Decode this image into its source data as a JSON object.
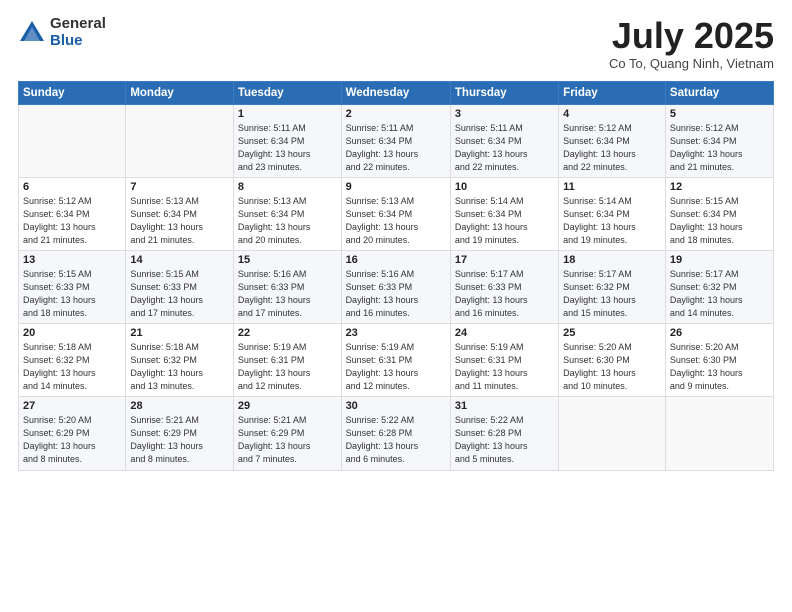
{
  "logo": {
    "general": "General",
    "blue": "Blue"
  },
  "title": "July 2025",
  "location": "Co To, Quang Ninh, Vietnam",
  "headers": [
    "Sunday",
    "Monday",
    "Tuesday",
    "Wednesday",
    "Thursday",
    "Friday",
    "Saturday"
  ],
  "weeks": [
    [
      {
        "day": "",
        "info": ""
      },
      {
        "day": "",
        "info": ""
      },
      {
        "day": "1",
        "info": "Sunrise: 5:11 AM\nSunset: 6:34 PM\nDaylight: 13 hours\nand 23 minutes."
      },
      {
        "day": "2",
        "info": "Sunrise: 5:11 AM\nSunset: 6:34 PM\nDaylight: 13 hours\nand 22 minutes."
      },
      {
        "day": "3",
        "info": "Sunrise: 5:11 AM\nSunset: 6:34 PM\nDaylight: 13 hours\nand 22 minutes."
      },
      {
        "day": "4",
        "info": "Sunrise: 5:12 AM\nSunset: 6:34 PM\nDaylight: 13 hours\nand 22 minutes."
      },
      {
        "day": "5",
        "info": "Sunrise: 5:12 AM\nSunset: 6:34 PM\nDaylight: 13 hours\nand 21 minutes."
      }
    ],
    [
      {
        "day": "6",
        "info": "Sunrise: 5:12 AM\nSunset: 6:34 PM\nDaylight: 13 hours\nand 21 minutes."
      },
      {
        "day": "7",
        "info": "Sunrise: 5:13 AM\nSunset: 6:34 PM\nDaylight: 13 hours\nand 21 minutes."
      },
      {
        "day": "8",
        "info": "Sunrise: 5:13 AM\nSunset: 6:34 PM\nDaylight: 13 hours\nand 20 minutes."
      },
      {
        "day": "9",
        "info": "Sunrise: 5:13 AM\nSunset: 6:34 PM\nDaylight: 13 hours\nand 20 minutes."
      },
      {
        "day": "10",
        "info": "Sunrise: 5:14 AM\nSunset: 6:34 PM\nDaylight: 13 hours\nand 19 minutes."
      },
      {
        "day": "11",
        "info": "Sunrise: 5:14 AM\nSunset: 6:34 PM\nDaylight: 13 hours\nand 19 minutes."
      },
      {
        "day": "12",
        "info": "Sunrise: 5:15 AM\nSunset: 6:34 PM\nDaylight: 13 hours\nand 18 minutes."
      }
    ],
    [
      {
        "day": "13",
        "info": "Sunrise: 5:15 AM\nSunset: 6:33 PM\nDaylight: 13 hours\nand 18 minutes."
      },
      {
        "day": "14",
        "info": "Sunrise: 5:15 AM\nSunset: 6:33 PM\nDaylight: 13 hours\nand 17 minutes."
      },
      {
        "day": "15",
        "info": "Sunrise: 5:16 AM\nSunset: 6:33 PM\nDaylight: 13 hours\nand 17 minutes."
      },
      {
        "day": "16",
        "info": "Sunrise: 5:16 AM\nSunset: 6:33 PM\nDaylight: 13 hours\nand 16 minutes."
      },
      {
        "day": "17",
        "info": "Sunrise: 5:17 AM\nSunset: 6:33 PM\nDaylight: 13 hours\nand 16 minutes."
      },
      {
        "day": "18",
        "info": "Sunrise: 5:17 AM\nSunset: 6:32 PM\nDaylight: 13 hours\nand 15 minutes."
      },
      {
        "day": "19",
        "info": "Sunrise: 5:17 AM\nSunset: 6:32 PM\nDaylight: 13 hours\nand 14 minutes."
      }
    ],
    [
      {
        "day": "20",
        "info": "Sunrise: 5:18 AM\nSunset: 6:32 PM\nDaylight: 13 hours\nand 14 minutes."
      },
      {
        "day": "21",
        "info": "Sunrise: 5:18 AM\nSunset: 6:32 PM\nDaylight: 13 hours\nand 13 minutes."
      },
      {
        "day": "22",
        "info": "Sunrise: 5:19 AM\nSunset: 6:31 PM\nDaylight: 13 hours\nand 12 minutes."
      },
      {
        "day": "23",
        "info": "Sunrise: 5:19 AM\nSunset: 6:31 PM\nDaylight: 13 hours\nand 12 minutes."
      },
      {
        "day": "24",
        "info": "Sunrise: 5:19 AM\nSunset: 6:31 PM\nDaylight: 13 hours\nand 11 minutes."
      },
      {
        "day": "25",
        "info": "Sunrise: 5:20 AM\nSunset: 6:30 PM\nDaylight: 13 hours\nand 10 minutes."
      },
      {
        "day": "26",
        "info": "Sunrise: 5:20 AM\nSunset: 6:30 PM\nDaylight: 13 hours\nand 9 minutes."
      }
    ],
    [
      {
        "day": "27",
        "info": "Sunrise: 5:20 AM\nSunset: 6:29 PM\nDaylight: 13 hours\nand 8 minutes."
      },
      {
        "day": "28",
        "info": "Sunrise: 5:21 AM\nSunset: 6:29 PM\nDaylight: 13 hours\nand 8 minutes."
      },
      {
        "day": "29",
        "info": "Sunrise: 5:21 AM\nSunset: 6:29 PM\nDaylight: 13 hours\nand 7 minutes."
      },
      {
        "day": "30",
        "info": "Sunrise: 5:22 AM\nSunset: 6:28 PM\nDaylight: 13 hours\nand 6 minutes."
      },
      {
        "day": "31",
        "info": "Sunrise: 5:22 AM\nSunset: 6:28 PM\nDaylight: 13 hours\nand 5 minutes."
      },
      {
        "day": "",
        "info": ""
      },
      {
        "day": "",
        "info": ""
      }
    ]
  ]
}
